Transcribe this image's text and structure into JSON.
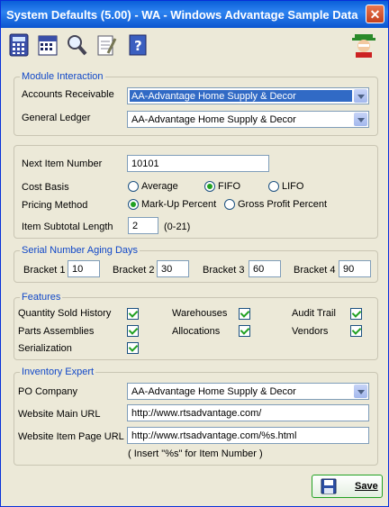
{
  "window": {
    "title": "System Defaults (5.00) - WA - Windows Advantage Sample Data",
    "close": "✕"
  },
  "toolbar": {
    "buttons": [
      "calculator-icon",
      "calendar-icon",
      "magnifier-icon",
      "notepad-icon",
      "help-book-icon"
    ],
    "logo": "mascot-icon"
  },
  "module": {
    "legend": "Module Interaction",
    "ar_label": "Accounts Receivable",
    "ar_value": "AA-Advantage Home Supply & Decor",
    "gl_label": "General Ledger",
    "gl_value": "AA-Advantage Home Supply & Decor"
  },
  "items": {
    "next_label": "Next Item Number",
    "next_value": "10101",
    "cost_label": "Cost Basis",
    "cost_options": [
      "Average",
      "FIFO",
      "LIFO"
    ],
    "cost_selected": "FIFO",
    "pricing_label": "Pricing Method",
    "pricing_options": [
      "Mark-Up Percent",
      "Gross Profit Percent"
    ],
    "pricing_selected": "Mark-Up Percent",
    "subtotal_label": "Item Subtotal Length",
    "subtotal_value": "2",
    "subtotal_range": "(0-21)"
  },
  "aging": {
    "legend": "Serial Number Aging Days",
    "brackets": [
      {
        "label": "Bracket 1",
        "value": "10"
      },
      {
        "label": "Bracket 2",
        "value": "30"
      },
      {
        "label": "Bracket 3",
        "value": "60"
      },
      {
        "label": "Bracket 4",
        "value": "90"
      }
    ]
  },
  "features": {
    "legend": "Features",
    "items": [
      {
        "label": "Quantity Sold History",
        "checked": true
      },
      {
        "label": "Warehouses",
        "checked": true
      },
      {
        "label": "Audit Trail",
        "checked": true
      },
      {
        "label": "Parts Assemblies",
        "checked": true
      },
      {
        "label": "Allocations",
        "checked": true
      },
      {
        "label": "Vendors",
        "checked": true
      },
      {
        "label": "Serialization",
        "checked": true
      }
    ]
  },
  "expert": {
    "legend": "Inventory Expert",
    "po_label": "PO Company",
    "po_value": "AA-Advantage Home Supply & Decor",
    "main_url_label": "Website Main URL",
    "main_url_value": "http://www.rtsadvantage.com/",
    "item_url_label": "Website Item Page URL",
    "item_url_value": "http://www.rtsadvantage.com/%s.html",
    "hint": "( Insert \"%s\" for Item Number )"
  },
  "save_label": "Save"
}
